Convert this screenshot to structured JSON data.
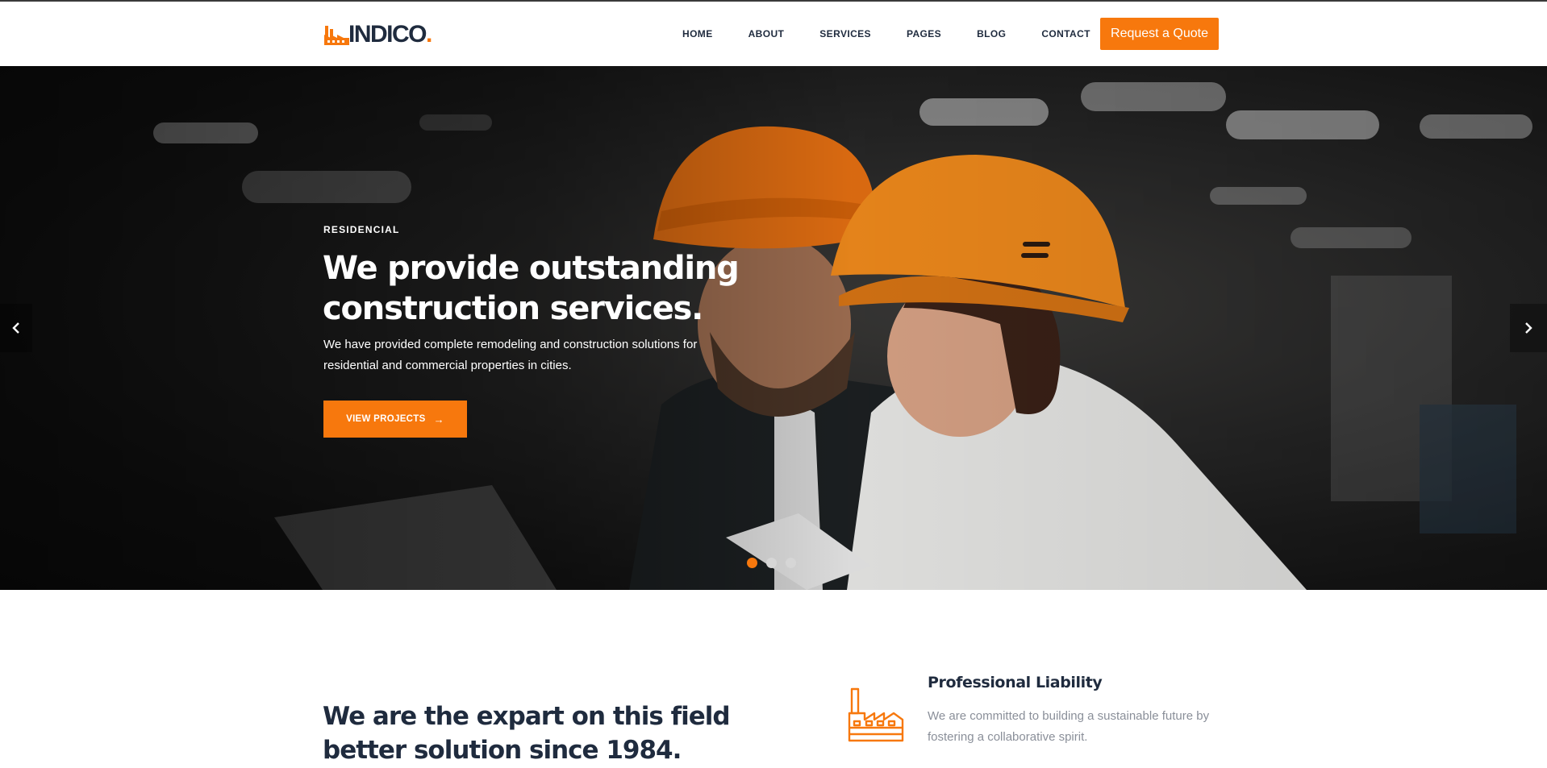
{
  "brand": {
    "name": "INDICO",
    "dot": ".",
    "accent_color": "#f7780d",
    "dark_color": "#1f2b3e"
  },
  "nav": {
    "items": [
      "HOME",
      "ABOUT",
      "SERVICES",
      "PAGES",
      "BLOG",
      "CONTACT"
    ],
    "cta_label": "Request a Quote"
  },
  "hero": {
    "eyebrow": "RESIDENCIAL",
    "title_line1": "We provide outstanding",
    "title_line2": "construction services.",
    "text_line1": "We have provided complete remodeling and construction solutions for",
    "text_line2": "residential and commercial properties in cities.",
    "button_label": "VIEW PROJECTS",
    "button_icon": "arrow-right-icon",
    "slides_count": 3,
    "active_slide": 1,
    "prev_icon": "chevron-left-icon",
    "next_icon": "chevron-right-icon"
  },
  "about": {
    "title_line1": "We are the expart on this field",
    "title_line2": "better solution since 1984."
  },
  "feature": {
    "icon": "factory-icon",
    "title": "Professional Liability",
    "text_line1": "We are committed to building a sustainable future by",
    "text_line2": "fostering a collaborative spirit."
  }
}
